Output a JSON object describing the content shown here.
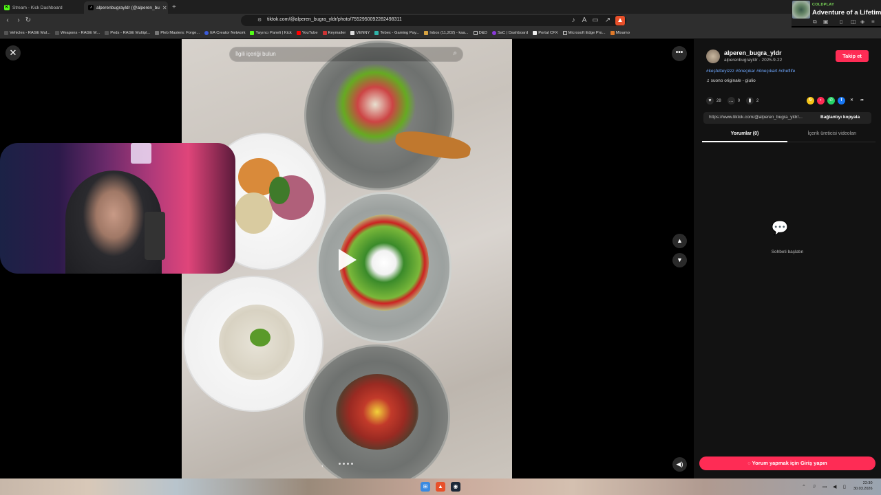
{
  "browser": {
    "tabs": [
      {
        "label": "Stream - Kick Dashboard",
        "active": false
      },
      {
        "label": "alperenbugrayldr (@alperen_bu",
        "active": true
      }
    ],
    "url": "tiktok.com/@alperen_bugra_yldr/photo/7552950092282498311",
    "bookmarks": [
      "Vehicles - RAGE Mul...",
      "Weapons - RAGE M...",
      "Peds - RAGE Multipl...",
      "Pleb Masters: Forge...",
      "EA Creator Network",
      "Yayıncı Paneli | Kick",
      "YouTube",
      "Keymailer",
      "VENNY",
      "Tebex - Gaming Pay...",
      "Inbox (11,202) - kaa...",
      "D&D",
      "SaC | Dashboard",
      "Portal CFX",
      "Microsoft Edge Pro...",
      "Mixamo"
    ]
  },
  "music": {
    "artist": "COLDPLAY",
    "song": "Adventure of a Lifetime"
  },
  "viewer": {
    "search_placeholder": "İlgili içeriği bulun"
  },
  "panel": {
    "username": "alperen_bugra_yldr",
    "subline": "alperenbugrayldr · 2025-9-22",
    "follow_label": "Takip et",
    "hashtags": "#keşfetteyizzz #öneçıkar #öneçıkart #cheflife",
    "sound": "suono originale - giulio",
    "likes": "28",
    "comments": "0",
    "saves": "2",
    "link_url": "https://www.tiktok.com/@alperen_bugra_yldr/...",
    "copy_label": "Bağlantıyı kopyala",
    "tab_comments": "Yorumlar (0)",
    "tab_videos": "İçerik üreticisi videoları",
    "empty_text": "Sohbeti başlatın",
    "login_label": "Yorum yapmak için Giriş yapın"
  },
  "taskbar": {
    "time": "22:30",
    "date": "30.03.2026"
  },
  "colors": {
    "accent": "#fe2c55",
    "hashtag": "#6fa8ff",
    "music_artist": "#7ddc5a"
  }
}
